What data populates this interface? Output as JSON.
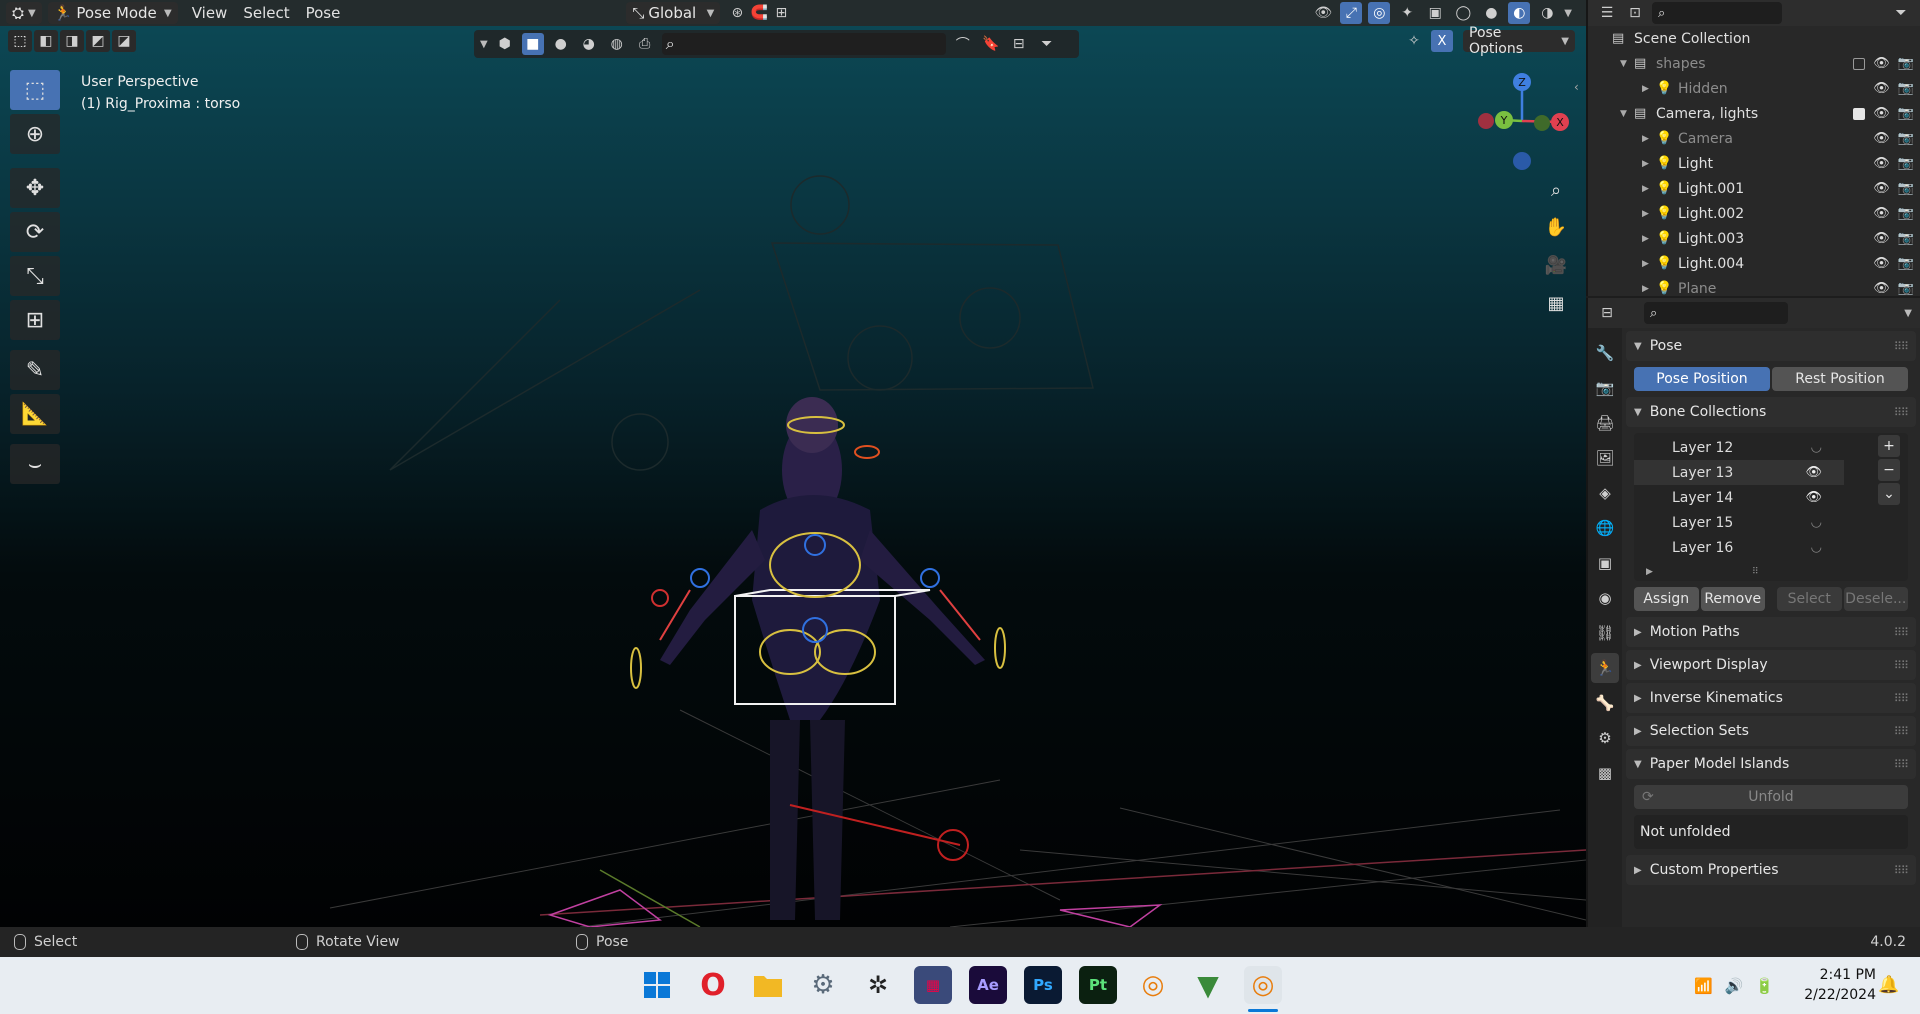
{
  "header": {
    "mode": "Pose Mode",
    "menus": [
      "View",
      "Select",
      "Pose"
    ],
    "orientation": "Global"
  },
  "viewport": {
    "perspective": "User Perspective",
    "active_object": "(1) Rig_Proxima : torso",
    "pose_options": "Pose Options",
    "gizmo": {
      "z": "Z",
      "y": "Y",
      "x": "X"
    }
  },
  "outliner": {
    "rows": [
      {
        "name": "Scene Collection",
        "indent": 0,
        "dim": false
      },
      {
        "name": "shapes",
        "indent": 1,
        "dim": true
      },
      {
        "name": "Hidden",
        "indent": 2,
        "dim": true
      },
      {
        "name": "Camera, lights",
        "indent": 1,
        "dim": false
      },
      {
        "name": "Camera",
        "indent": 2,
        "dim": true
      },
      {
        "name": "Light",
        "indent": 2,
        "dim": false
      },
      {
        "name": "Light.001",
        "indent": 2,
        "dim": false
      },
      {
        "name": "Light.002",
        "indent": 2,
        "dim": false
      },
      {
        "name": "Light.003",
        "indent": 2,
        "dim": false
      },
      {
        "name": "Light.004",
        "indent": 2,
        "dim": false
      },
      {
        "name": "Plane",
        "indent": 2,
        "dim": true
      }
    ]
  },
  "properties": {
    "pose_panel": "Pose",
    "pose_position": "Pose Position",
    "rest_position": "Rest Position",
    "bone_collections": "Bone Collections",
    "layers": [
      {
        "name": "Layer 12",
        "visible": false
      },
      {
        "name": "Layer 13",
        "visible": true
      },
      {
        "name": "Layer 14",
        "visible": true
      },
      {
        "name": "Layer 15",
        "visible": false
      },
      {
        "name": "Layer 16",
        "visible": false
      }
    ],
    "assign": "Assign",
    "remove": "Remove",
    "select": "Select",
    "deselect": "Desele...",
    "panels": [
      "Motion Paths",
      "Viewport Display",
      "Inverse Kinematics",
      "Selection Sets"
    ],
    "paper_model": "Paper Model Islands",
    "unfold": "Unfold",
    "not_unfolded": "Not unfolded",
    "custom_properties": "Custom Properties"
  },
  "statusbar": {
    "select": "Select",
    "rotate": "Rotate View",
    "pose": "Pose",
    "version": "4.0.2"
  },
  "taskbar": {
    "time": "2:41 PM",
    "date": "2/22/2024",
    "apps": [
      "Ae",
      "Ps",
      "Pt"
    ]
  }
}
